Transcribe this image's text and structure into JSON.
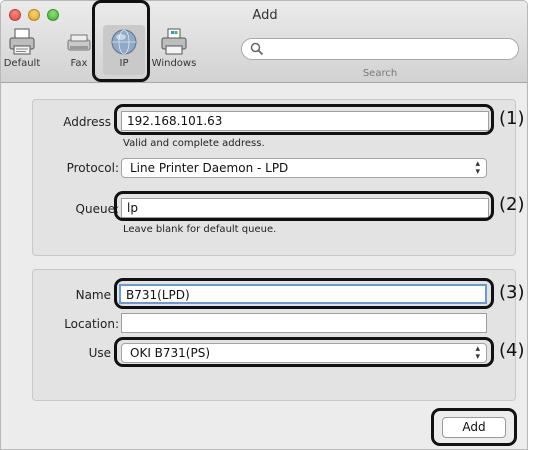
{
  "window": {
    "title": "Add"
  },
  "toolbar": {
    "items": [
      {
        "label": "Default",
        "icon": "printer-icon"
      },
      {
        "label": "Fax",
        "icon": "fax-icon"
      },
      {
        "label": "IP",
        "icon": "globe-icon"
      },
      {
        "label": "Windows",
        "icon": "windows-printer-icon"
      }
    ],
    "search": {
      "label": "Search",
      "value": ""
    }
  },
  "connection": {
    "address_label": "Address",
    "address_value": "192.168.101.63",
    "address_hint": "Valid and complete address.",
    "protocol_label": "Protocol:",
    "protocol_value": "Line Printer Daemon - LPD",
    "queue_label": "Queue:",
    "queue_value": "lp",
    "queue_hint": "Leave blank for default queue."
  },
  "printer": {
    "name_label": "Name",
    "name_value": "B731(LPD)",
    "location_label": "Location:",
    "location_value": "",
    "use_label": "Use",
    "use_value": "OKI B731(PS)"
  },
  "buttons": {
    "add_label": "Add"
  },
  "callouts": [
    "(1)",
    "(2)",
    "(3)",
    "(4)"
  ]
}
